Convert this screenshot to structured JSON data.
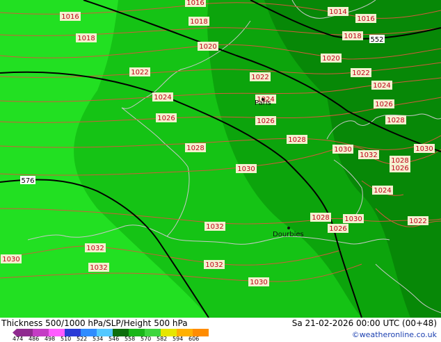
{
  "map": {
    "slp_labels": [
      {
        "text": "1016",
        "color": "#c0001a"
      },
      {
        "text": "1016",
        "color": "#c0001a"
      },
      {
        "text": "1014",
        "color": "#c0001a"
      },
      {
        "text": "1016",
        "color": "#c0001a"
      },
      {
        "text": "1018",
        "color": "#c0001a"
      },
      {
        "text": "1018",
        "color": "#c0001a"
      },
      {
        "text": "1018",
        "color": "#c0001a"
      },
      {
        "text": "1020",
        "color": "#c0001a"
      },
      {
        "text": "1020",
        "color": "#c0001a"
      },
      {
        "text": "1022",
        "color": "#c0001a"
      },
      {
        "text": "1022",
        "color": "#c0001a"
      },
      {
        "text": "1022",
        "color": "#c0001a"
      },
      {
        "text": "1024",
        "color": "#c0001a"
      },
      {
        "text": "1024",
        "color": "#c0001a"
      },
      {
        "text": "1024",
        "color": "#c0001a"
      },
      {
        "text": "1026",
        "color": "#c0001a"
      },
      {
        "text": "1026",
        "color": "#c0001a"
      },
      {
        "text": "1026",
        "color": "#c0001a"
      },
      {
        "text": "1028",
        "color": "#c0001a"
      },
      {
        "text": "1028",
        "color": "#c0001a"
      },
      {
        "text": "1028",
        "color": "#c0001a"
      },
      {
        "text": "1030",
        "color": "#c0001a"
      },
      {
        "text": "1030",
        "color": "#c0001a"
      },
      {
        "text": "1032",
        "color": "#c0001a"
      },
      {
        "text": "1030",
        "color": "#c0001a"
      },
      {
        "text": "1028",
        "color": "#c0001a"
      },
      {
        "text": "1026",
        "color": "#c0001a"
      },
      {
        "text": "1024",
        "color": "#c0001a"
      },
      {
        "text": "1028",
        "color": "#c0001a"
      },
      {
        "text": "1030",
        "color": "#c0001a"
      },
      {
        "text": "1026",
        "color": "#c0001a"
      },
      {
        "text": "1022",
        "color": "#c0001a"
      },
      {
        "text": "1032",
        "color": "#c0001a"
      },
      {
        "text": "1032",
        "color": "#c0001a"
      },
      {
        "text": "1030",
        "color": "#c0001a"
      },
      {
        "text": "1032",
        "color": "#c0001a"
      },
      {
        "text": "1032",
        "color": "#c0001a"
      },
      {
        "text": "1030",
        "color": "#c0001a"
      }
    ],
    "height_labels": [
      {
        "text": "552",
        "color": "#000000"
      },
      {
        "text": "576",
        "color": "#000000"
      }
    ],
    "cities": [
      {
        "name": "Paris"
      },
      {
        "name": "Dourbies"
      }
    ]
  },
  "footer": {
    "title": "Thickness 500/1000 hPa/SLP/Height 500 hPa",
    "datetime": "Sa 21-02-2026 00:00 UTC (00+48)",
    "credit": "©weatheronline.co.uk"
  },
  "legend": {
    "ticks": [
      "474",
      "486",
      "498",
      "510",
      "522",
      "534",
      "546",
      "558",
      "570",
      "582",
      "594",
      "606"
    ],
    "colors": [
      "#8f2a8f",
      "#c43cc4",
      "#ff5cff",
      "#2a3ad6",
      "#2f8cff",
      "#52c8ff",
      "#0c6e0c",
      "#1ab61a",
      "#3ed63e",
      "#e6e600",
      "#ffb000",
      "#ff8c00"
    ]
  },
  "colors": {
    "thickness_light": "#22e022",
    "thickness_mid": "#15c315",
    "thickness_dark": "#0ca40c",
    "thickness_darker": "#078807",
    "isobar": "#d25a3c",
    "height_contour": "#000000",
    "coastline": "#c8c8c8"
  }
}
